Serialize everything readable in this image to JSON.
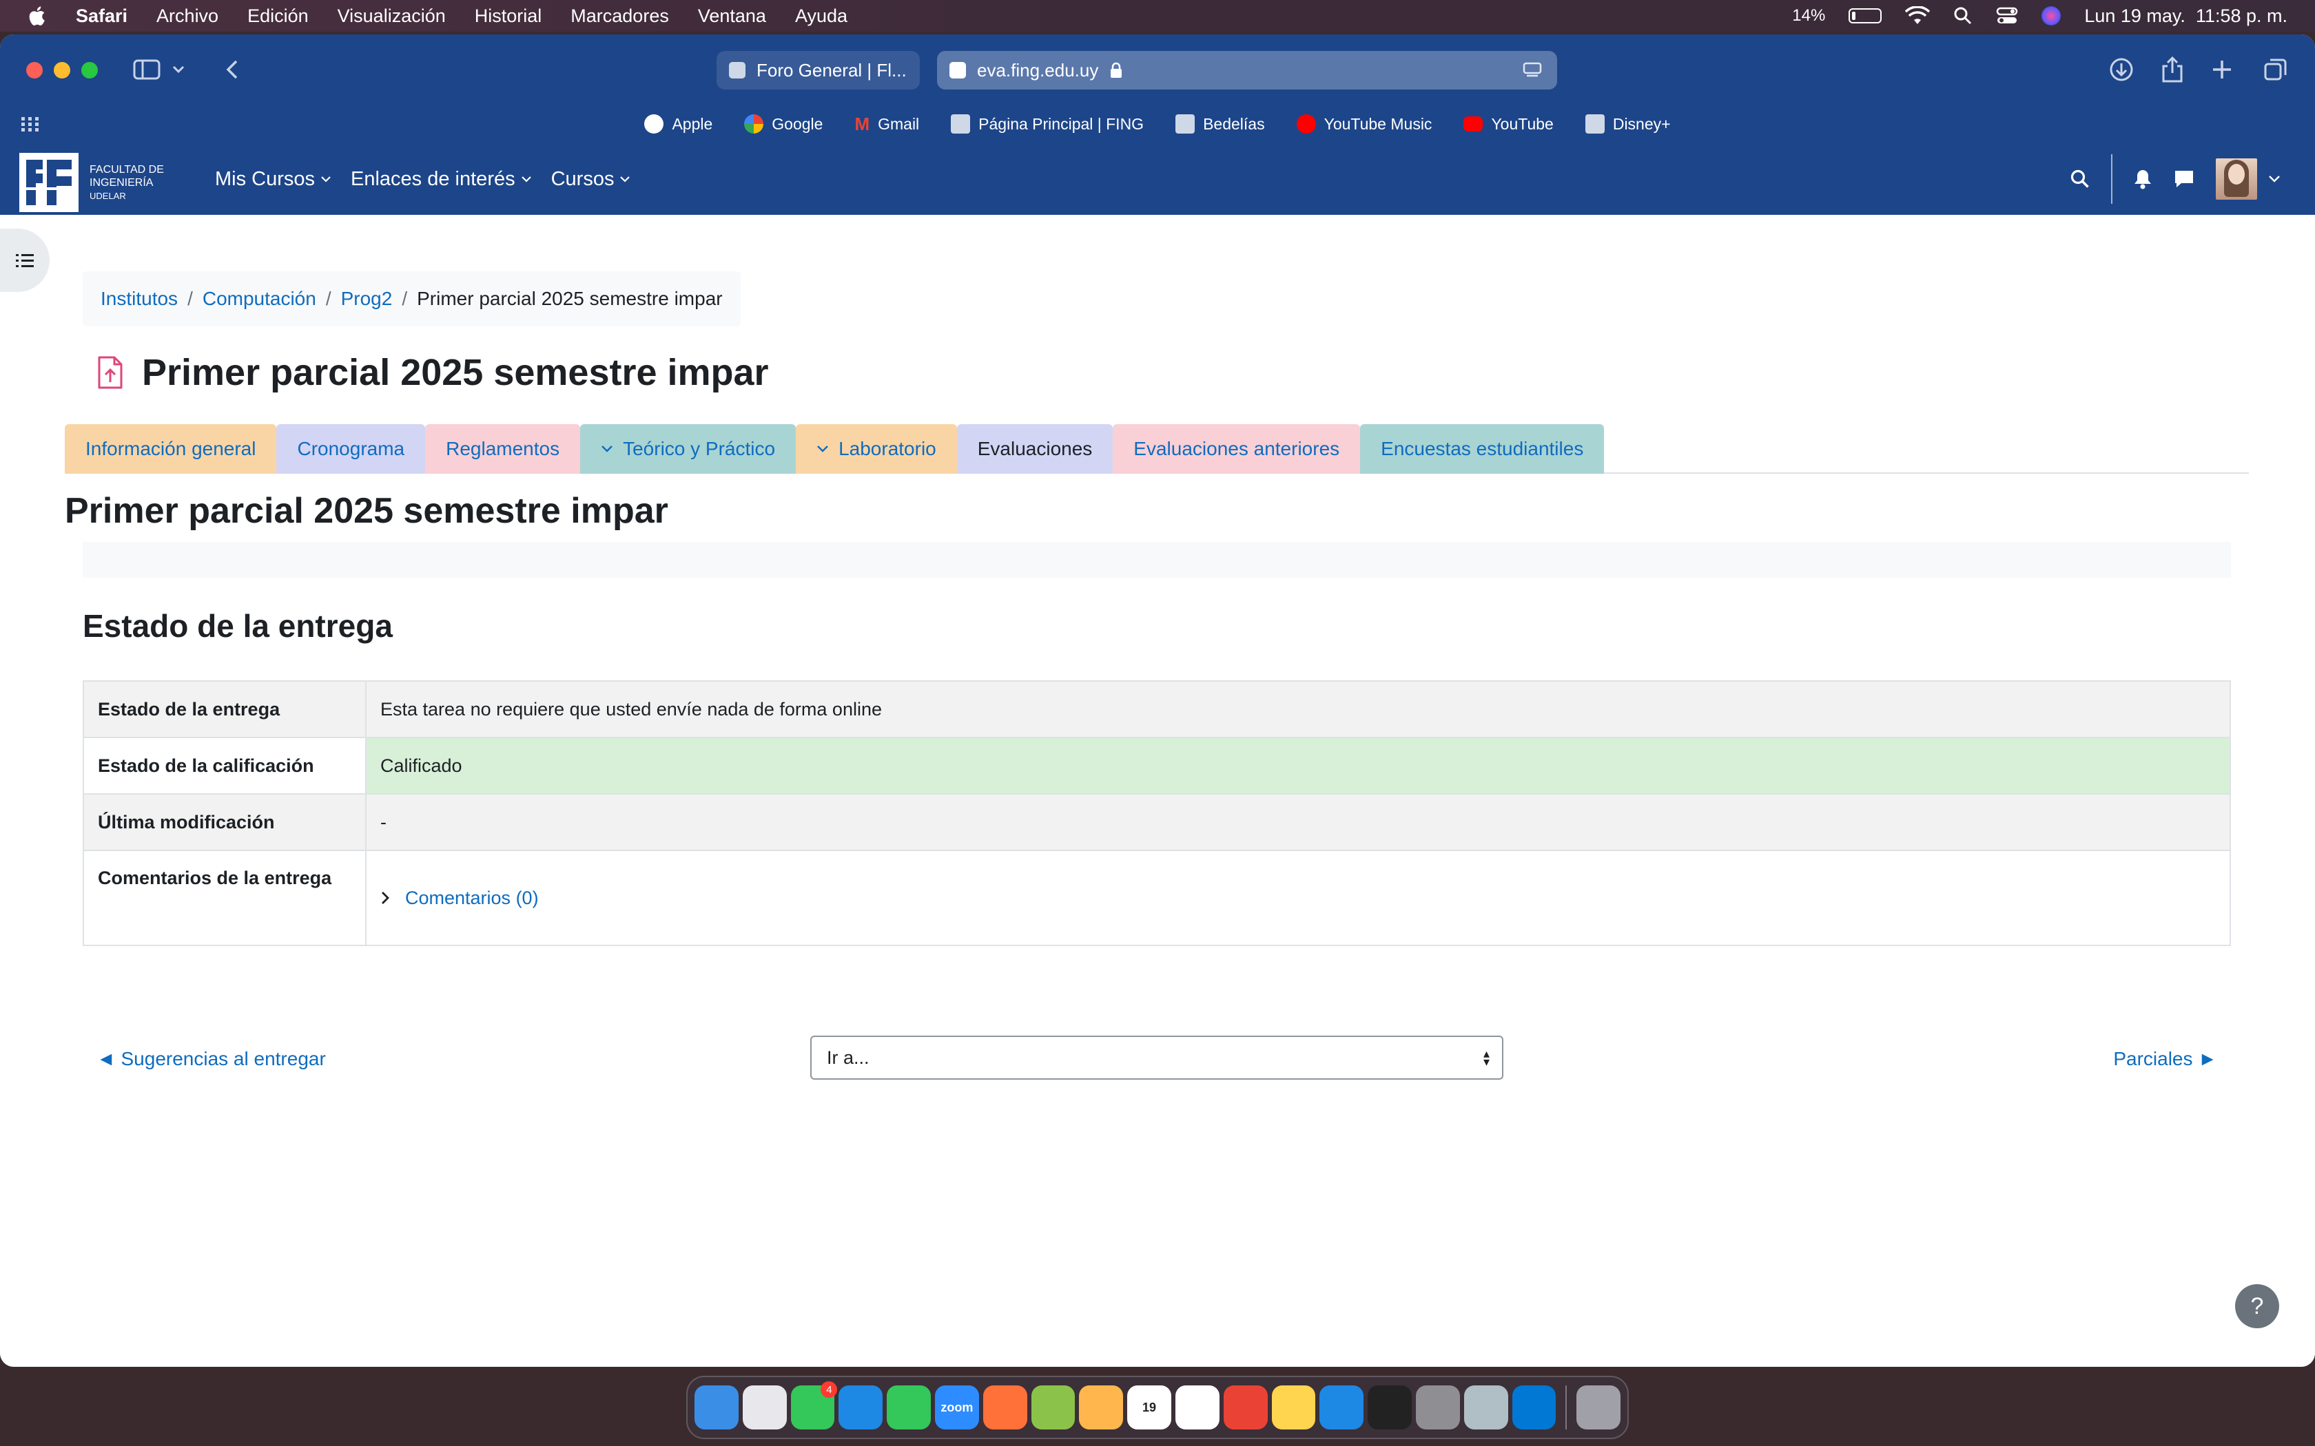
{
  "menubar": {
    "app": "Safari",
    "items": [
      "Archivo",
      "Edición",
      "Visualización",
      "Historial",
      "Marcadores",
      "Ventana",
      "Ayuda"
    ],
    "battery": "14%",
    "battery_level": 0.14,
    "datetime": "Lun 19 may.  11:58 p. m."
  },
  "browser": {
    "tabs": [
      {
        "title": "Foro General | Fl..."
      },
      {
        "title": "eva.fing.edu.uy"
      }
    ],
    "bookmarks": [
      {
        "label": "Apple",
        "color": "#ffffff"
      },
      {
        "label": "Google",
        "color": "#4285f4"
      },
      {
        "label": "Gmail",
        "color": "#ea4335"
      },
      {
        "label": "Página Principal | FING",
        "color": "#cfd8e6"
      },
      {
        "label": "Bedelías",
        "color": "#cfd8e6"
      },
      {
        "label": "YouTube Music",
        "color": "#ff0000"
      },
      {
        "label": "YouTube",
        "color": "#ff0000"
      },
      {
        "label": "Disney+",
        "color": "#cfd8e6"
      }
    ]
  },
  "navbar": {
    "logo_text": [
      "FACULTAD DE",
      "INGENIERÍA",
      "UDELAR"
    ],
    "links": [
      "Mis Cursos",
      "Enlaces de interés",
      "Cursos"
    ]
  },
  "breadcrumb": [
    "Institutos",
    "Computación",
    "Prog2",
    "Primer parcial 2025 semestre impar"
  ],
  "page_title": "Primer parcial 2025 semestre impar",
  "course_tabs": [
    {
      "label": "Información general",
      "bg": "#f9d5a6",
      "chevron": false
    },
    {
      "label": "Cronograma",
      "bg": "#d3d5f5",
      "chevron": false
    },
    {
      "label": "Reglamentos",
      "bg": "#f9d0d6",
      "chevron": false
    },
    {
      "label": "Teórico y Práctico",
      "bg": "#a9d4d4",
      "chevron": true
    },
    {
      "label": "Laboratorio",
      "bg": "#f9d5a6",
      "chevron": true
    },
    {
      "label": "Evaluaciones",
      "bg": "#d3d5f5",
      "chevron": false,
      "active": true
    },
    {
      "label": "Evaluaciones anteriores",
      "bg": "#f9d0d6",
      "chevron": false
    },
    {
      "label": "Encuestas estudiantiles",
      "bg": "#a9d4d4",
      "chevron": false
    }
  ],
  "main": {
    "title": "Primer parcial 2025 semestre impar",
    "section_title": "Estado de la entrega",
    "status_table": [
      {
        "label": "Estado de la entrega",
        "value": "Esta tarea no requiere que usted envíe nada de forma online"
      },
      {
        "label": "Estado de la calificación",
        "value": "Calificado"
      },
      {
        "label": "Última modificación",
        "value": "-"
      },
      {
        "label": "Comentarios de la entrega",
        "value": "Comentarios (0)"
      }
    ]
  },
  "activity_nav": {
    "prev": "◄ Sugerencias al entregar",
    "jump_placeholder": "Ir a...",
    "next": "Parciales ►"
  },
  "help": "?",
  "dock": {
    "apps": [
      {
        "name": "Finder",
        "color": "#3a8ee6"
      },
      {
        "name": "Launchpad",
        "color": "#e7e7ec"
      },
      {
        "name": "FaceTime",
        "color": "#34c759",
        "badge": "4"
      },
      {
        "name": "Safari",
        "color": "#1e88e5"
      },
      {
        "name": "Messages",
        "color": "#34c759"
      },
      {
        "name": "Zoom",
        "color": "#2d8cff",
        "text": "zoom"
      },
      {
        "name": "Firefox",
        "color": "#ff7139"
      },
      {
        "name": "Maps",
        "color": "#8bc34a"
      },
      {
        "name": "Photos",
        "color": "#ffb74d"
      },
      {
        "name": "Calendar",
        "color": "#ffffff",
        "text": "19"
      },
      {
        "name": "Reminders",
        "color": "#ffffff"
      },
      {
        "name": "Chrome",
        "color": "#ea4335"
      },
      {
        "name": "Notes",
        "color": "#ffd54f"
      },
      {
        "name": "App Store",
        "color": "#1e88e5"
      },
      {
        "name": "Terminal",
        "color": "#222222"
      },
      {
        "name": "System Settings",
        "color": "#8e8e93"
      },
      {
        "name": "Preview",
        "color": "#b0bec5"
      },
      {
        "name": "VS Code",
        "color": "#0078d4"
      }
    ],
    "trash": {
      "name": "Trash",
      "color": "#a0a0a8"
    }
  }
}
